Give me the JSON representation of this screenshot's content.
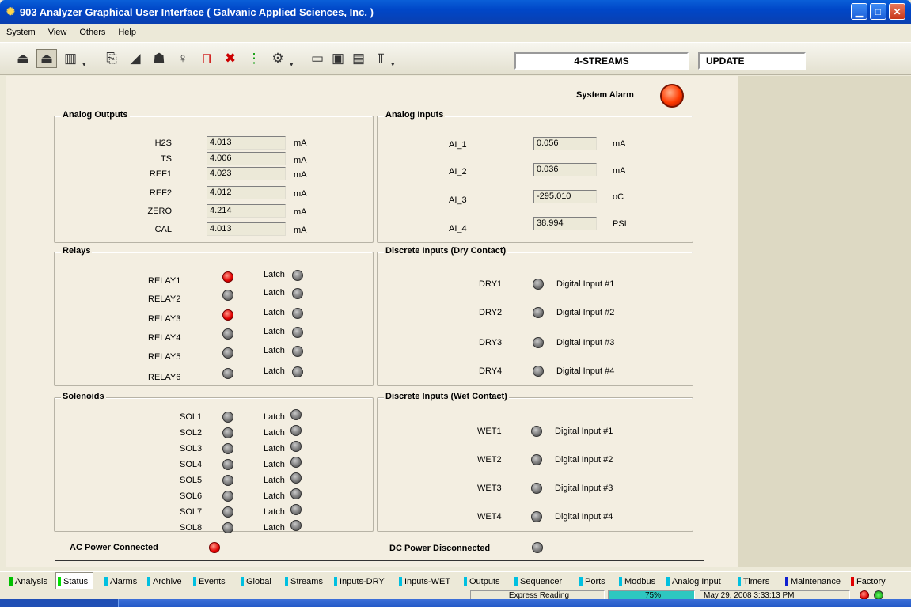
{
  "window": {
    "title": "903 Analyzer Graphical User Interface  ( Galvanic Applied Sciences, Inc. )"
  },
  "menu": [
    "System",
    "View",
    "Others",
    "Help"
  ],
  "toolbar": {
    "streams_label": "4-STREAMS",
    "update_label": "UPDATE"
  },
  "system_alarm": {
    "label": "System Alarm"
  },
  "analog_outputs": {
    "title": "Analog Outputs",
    "rows": [
      {
        "name": "H2S",
        "value": "4.013",
        "unit": "mA"
      },
      {
        "name": "TS",
        "value": "4.006",
        "unit": "mA"
      },
      {
        "name": "REF1",
        "value": "4.023",
        "unit": "mA"
      },
      {
        "name": "REF2",
        "value": "4.012",
        "unit": "mA"
      },
      {
        "name": "ZERO",
        "value": "4.214",
        "unit": "mA"
      },
      {
        "name": "CAL",
        "value": "4.013",
        "unit": "mA"
      }
    ]
  },
  "analog_inputs": {
    "title": "Analog Inputs",
    "rows": [
      {
        "name": "AI_1",
        "value": "0.056",
        "unit": "mA"
      },
      {
        "name": "AI_2",
        "value": "0.036",
        "unit": "mA"
      },
      {
        "name": "AI_3",
        "value": "-295.010",
        "unit": "oC"
      },
      {
        "name": "AI_4",
        "value": "38.994",
        "unit": "PSI"
      }
    ]
  },
  "relays": {
    "title": "Relays",
    "latch_label": "Latch",
    "rows": [
      {
        "name": "RELAY1",
        "state": "on"
      },
      {
        "name": "RELAY2",
        "state": "off"
      },
      {
        "name": "RELAY3",
        "state": "on"
      },
      {
        "name": "RELAY4",
        "state": "off"
      },
      {
        "name": "RELAY5",
        "state": "off"
      },
      {
        "name": "RELAY6",
        "state": "off"
      }
    ]
  },
  "dry_inputs": {
    "title": "Discrete Inputs (Dry Contact)",
    "rows": [
      {
        "name": "DRY1",
        "desc": "Digital Input #1"
      },
      {
        "name": "DRY2",
        "desc": "Digital Input #2"
      },
      {
        "name": "DRY3",
        "desc": "Digital Input #3"
      },
      {
        "name": "DRY4",
        "desc": "Digital Input #4"
      }
    ]
  },
  "solenoids": {
    "title": "Solenoids",
    "latch_label": "Latch",
    "rows": [
      "SOL1",
      "SOL2",
      "SOL3",
      "SOL4",
      "SOL5",
      "SOL6",
      "SOL7",
      "SOL8"
    ]
  },
  "wet_inputs": {
    "title": "Discrete Inputs (Wet Contact)",
    "rows": [
      {
        "name": "WET1",
        "desc": "Digital Input #1"
      },
      {
        "name": "WET2",
        "desc": "Digital Input #2"
      },
      {
        "name": "WET3",
        "desc": "Digital Input #3"
      },
      {
        "name": "WET4",
        "desc": "Digital Input #4"
      }
    ]
  },
  "power": {
    "ac_label": "AC Power Connected",
    "dc_label": "DC Power Disconnected"
  },
  "tabs": [
    {
      "label": "Analysis",
      "color": "#00c000"
    },
    {
      "label": "Status",
      "color": "#00e000",
      "active": true
    },
    {
      "label": "Alarms",
      "color": "#00c0e0"
    },
    {
      "label": "Archive",
      "color": "#00c0e0"
    },
    {
      "label": "Events",
      "color": "#00c0e0"
    },
    {
      "label": "Global",
      "color": "#00c0e0"
    },
    {
      "label": "Streams",
      "color": "#00c0e0"
    },
    {
      "label": "Inputs-DRY",
      "color": "#00c0e0"
    },
    {
      "label": "Inputs-WET",
      "color": "#00c0e0"
    },
    {
      "label": "Outputs",
      "color": "#00c0e0"
    },
    {
      "label": "Sequencer",
      "color": "#00c0e0"
    },
    {
      "label": "Ports",
      "color": "#00c0e0"
    },
    {
      "label": "Modbus",
      "color": "#00c0e0"
    },
    {
      "label": "Analog Input",
      "color": "#00c0e0"
    },
    {
      "label": "Timers",
      "color": "#00c0e0"
    },
    {
      "label": "Maintenance",
      "color": "#1020d0"
    },
    {
      "label": "Factory",
      "color": "#e00000"
    }
  ],
  "statusbar": {
    "reading": "Express Reading",
    "percent": "75%",
    "datetime": "May 29, 2008 3:33:13 PM"
  }
}
